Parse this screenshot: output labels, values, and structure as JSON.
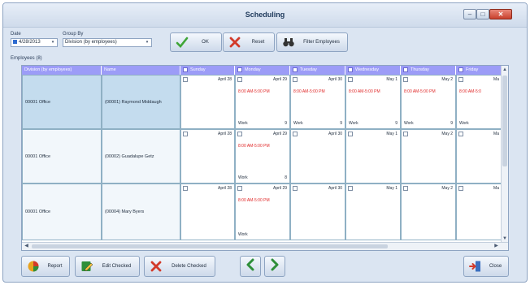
{
  "window": {
    "title": "Scheduling",
    "controls": {
      "minimize": "–",
      "maximize": "□",
      "close": "✕"
    }
  },
  "filters": {
    "date_label": "Date",
    "date_value": "4/28/2013",
    "group_by_label": "Group By",
    "group_by_value": "Division (by employees)",
    "employees_label": "Employees (8)"
  },
  "toolbar": {
    "ok_label": "OK",
    "reset_label": "Reset",
    "filter_label": "Filter Employees"
  },
  "grid": {
    "columns": [
      "Division (by employees)",
      "Name",
      "Sunday",
      "Monday",
      "Tuesday",
      "Wednesday",
      "Thursday",
      "Friday"
    ],
    "rows": [
      {
        "division": "00001 Office",
        "name": "(00001) Raymond Middaugh",
        "days": [
          {
            "date": "April 28",
            "shift": "",
            "type": "",
            "hours": ""
          },
          {
            "date": "April 29",
            "shift": "8:00 AM-5:00 PM",
            "type": "Work",
            "hours": "9"
          },
          {
            "date": "April 30",
            "shift": "8:00 AM-5:00 PM",
            "type": "Work",
            "hours": "9"
          },
          {
            "date": "May 1",
            "shift": "8:00 AM-5:00 PM",
            "type": "Work",
            "hours": "9"
          },
          {
            "date": "May 2",
            "shift": "8:00 AM-5:00 PM",
            "type": "Work",
            "hours": "9"
          },
          {
            "date": "Ma",
            "shift": "8:00 AM-5:0",
            "type": "Work",
            "hours": ""
          }
        ]
      },
      {
        "division": "00001 Office",
        "name": "(00002) Guadalupe Getz",
        "days": [
          {
            "date": "April 28",
            "shift": "",
            "type": "",
            "hours": ""
          },
          {
            "date": "April 29",
            "shift": "8:00 AM-5:00 PM",
            "type": "Work",
            "hours": "8"
          },
          {
            "date": "April 30",
            "shift": "",
            "type": "",
            "hours": ""
          },
          {
            "date": "May 1",
            "shift": "",
            "type": "",
            "hours": ""
          },
          {
            "date": "May 2",
            "shift": "",
            "type": "",
            "hours": ""
          },
          {
            "date": "Ma",
            "shift": "",
            "type": "",
            "hours": ""
          }
        ]
      },
      {
        "division": "00001 Office",
        "name": "(00004) Mary Byers",
        "days": [
          {
            "date": "April 28",
            "shift": "",
            "type": "",
            "hours": ""
          },
          {
            "date": "April 29",
            "shift": "8:00 AM-5:00 PM",
            "type": "Work",
            "hours": ""
          },
          {
            "date": "April 30",
            "shift": "",
            "type": "",
            "hours": ""
          },
          {
            "date": "May 1",
            "shift": "",
            "type": "",
            "hours": ""
          },
          {
            "date": "May 2",
            "shift": "",
            "type": "",
            "hours": ""
          },
          {
            "date": "Ma",
            "shift": "",
            "type": "",
            "hours": ""
          }
        ]
      }
    ]
  },
  "footer": {
    "report_label": "Report",
    "edit_checked_label": "Edit Checked",
    "delete_checked_label": "Delete Checked",
    "close_label": "Close"
  },
  "colors": {
    "header": "#9c9cf7",
    "shift_text": "#e02828",
    "selected_cell": "#c4dcee"
  }
}
